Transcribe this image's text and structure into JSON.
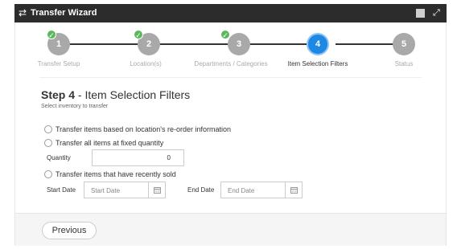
{
  "window": {
    "title": "Transfer Wizard",
    "swap_icon": "⇄",
    "expand_icon": "⤢"
  },
  "wizard": {
    "steps": [
      {
        "number": "1",
        "label": "Transfer Setup",
        "completed": true
      },
      {
        "number": "2",
        "label": "Location(s)",
        "completed": true
      },
      {
        "number": "3",
        "label": "Departments / Categories",
        "completed": true
      },
      {
        "number": "4",
        "label": "Item Selection Filters",
        "active": true
      },
      {
        "number": "5",
        "label": "Status"
      }
    ],
    "check_icon": "✓"
  },
  "content": {
    "step_prefix": "Step 4",
    "step_title": " - Item Selection Filters",
    "subtitle": "Select inventory to transfer",
    "option_reorder": "Transfer items based on location's re-order information",
    "option_fixed": "Transfer all items at fixed quantity",
    "quantity_label": "Quantity",
    "quantity_value": "0",
    "option_recent": "Transfer items that have recently sold",
    "start_date_label": "Start Date",
    "start_date_placeholder": "Start Date",
    "end_date_label": "End Date",
    "end_date_placeholder": "End Date",
    "calendar_icon": "▦"
  },
  "footer": {
    "previous_label": "Previous"
  },
  "colors": {
    "titlebar_bg": "#2c2c2c",
    "active_step": "#1e88e5",
    "inactive_step": "#a9a9a9",
    "completed_check": "#5cb85c"
  }
}
